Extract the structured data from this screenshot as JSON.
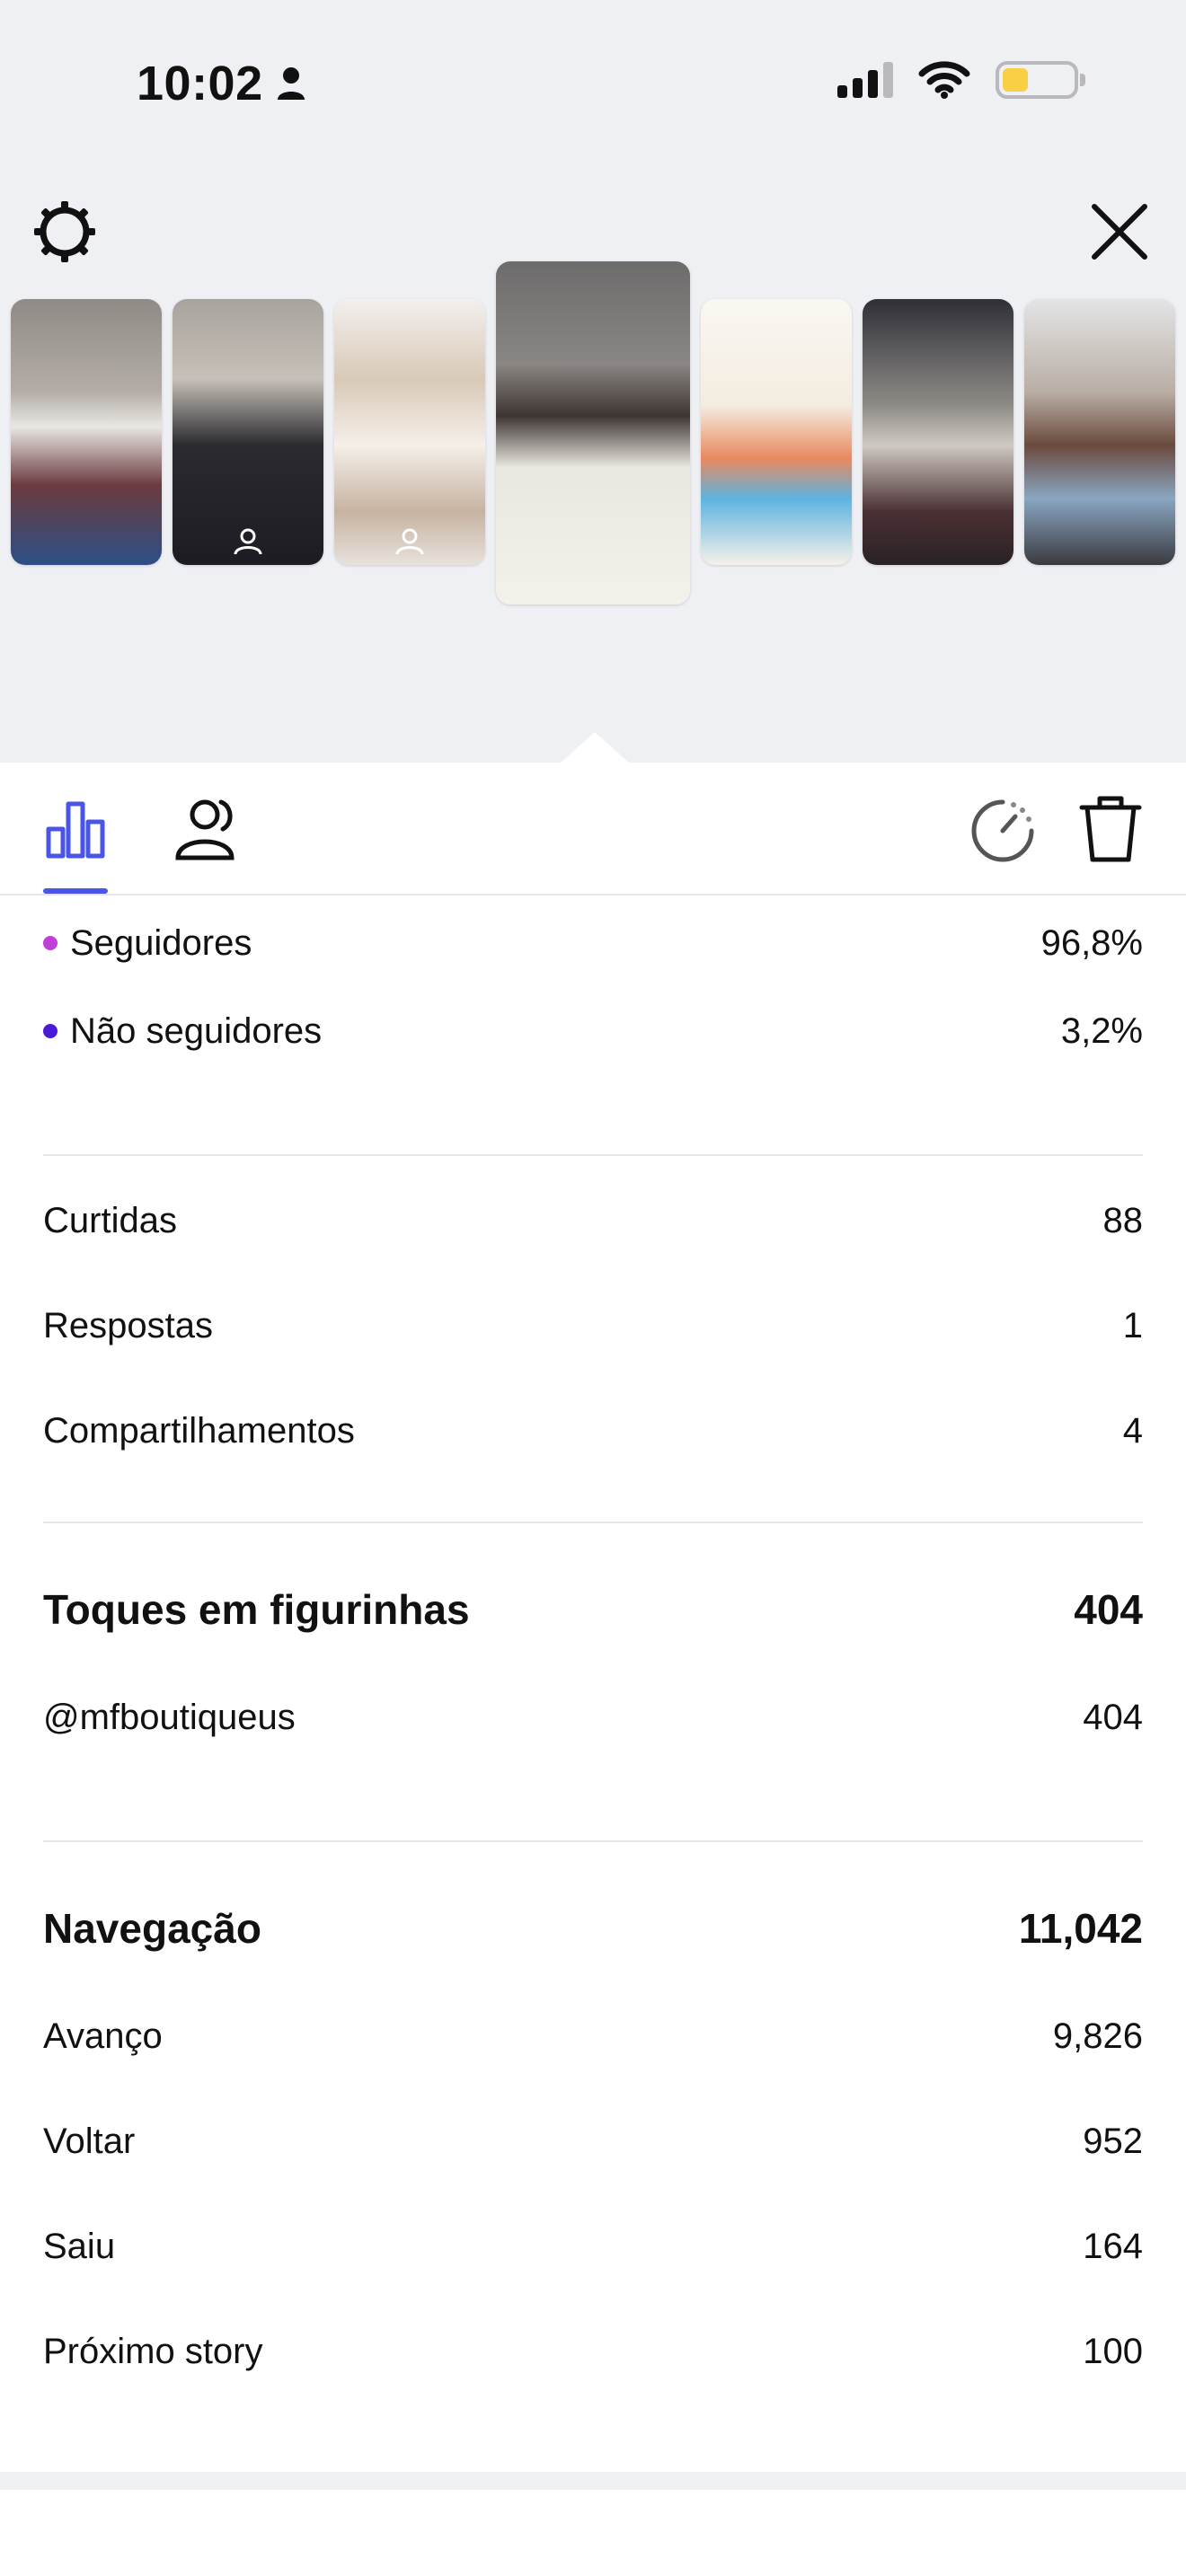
{
  "status_bar": {
    "time": "10:02"
  },
  "audience": {
    "items": [
      {
        "label": "Seguidores",
        "value": "96,8%",
        "dot_color": "#c13fd8"
      },
      {
        "label": "Não seguidores",
        "value": "3,2%",
        "dot_color": "#4a1bd6"
      }
    ]
  },
  "interactions": {
    "items": [
      {
        "label": "Curtidas",
        "value": "88"
      },
      {
        "label": "Respostas",
        "value": "1"
      },
      {
        "label": "Compartilhamentos",
        "value": "4"
      }
    ]
  },
  "sticker_taps": {
    "title": "Toques em figurinhas",
    "total": "404",
    "items": [
      {
        "label": "@mfboutiqueus",
        "value": "404"
      }
    ]
  },
  "navigation": {
    "title": "Navegação",
    "total": "11,042",
    "items": [
      {
        "label": "Avanço",
        "value": "9,826"
      },
      {
        "label": "Voltar",
        "value": "952"
      },
      {
        "label": "Saiu",
        "value": "164"
      },
      {
        "label": "Próximo story",
        "value": "100"
      }
    ]
  },
  "colors": {
    "accent": "#4a55e8",
    "header_bg": "#eff0f4"
  }
}
